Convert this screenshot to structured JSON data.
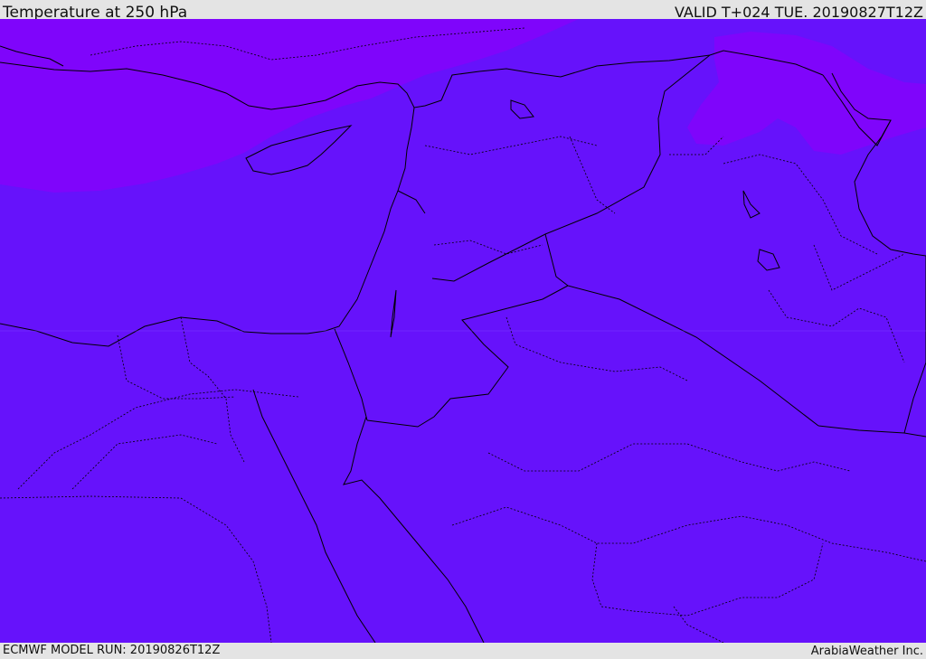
{
  "header": {
    "title": "Temperature at 250 hPa",
    "valid": "VALID T+024 TUE. 20190827T12Z"
  },
  "footer": {
    "model_run": "ECMWF MODEL RUN: 20190826T12Z",
    "credit": "ArabiaWeather Inc."
  },
  "map": {
    "field_colors": {
      "main": "#6612fb",
      "cold_pool": "#7f05fb",
      "boundary_line": "#000000"
    }
  }
}
